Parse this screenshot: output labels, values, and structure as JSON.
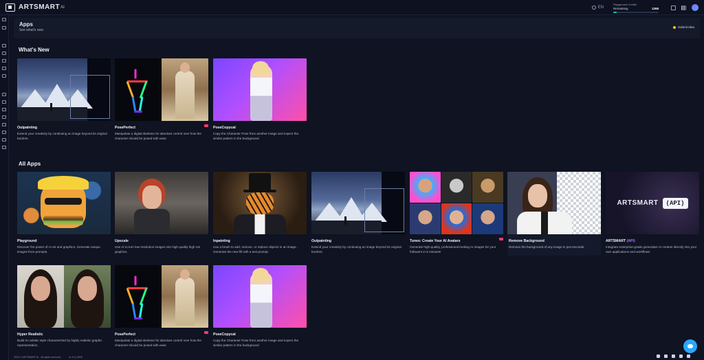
{
  "brand": {
    "name": "ARTSMART",
    "suffix": "AI"
  },
  "topbar": {
    "language": "EN",
    "credits_label": "Playground Credits",
    "credits_remaining_label": "Remaining",
    "credits_value": "1268",
    "credits_progress": 0.08
  },
  "header": {
    "title": "Apps",
    "subtitle": "See what's new",
    "submit_idea": "Submit Idea"
  },
  "sections": {
    "whats_new": "What's New",
    "all_apps": "All Apps"
  },
  "whats_new": [
    {
      "title": "Outpainting",
      "desc": "Extend your creativity by continuing an image beyond its original borders.",
      "badge": false
    },
    {
      "title": "PosePerfect",
      "desc": "Manipulate a digital skeleton for absolute control over how the character should be posed with ease",
      "badge": true
    },
    {
      "title": "PoseCopycat",
      "desc": "Copy the Character Pose from another image and expect the similar pattern in the background",
      "badge": false
    }
  ],
  "all_apps": [
    {
      "title": "Playground",
      "desc": "Discover the power of AI art and graphics. Generate unique images from prompts."
    },
    {
      "title": "Upscale",
      "desc": "Use AI to turn low resolution images into high quality high res graphics."
    },
    {
      "title": "Inpainting",
      "desc": "Use a brush to add, remove, or replace objects in an image. Generate the new fill with a text prompt."
    },
    {
      "title": "Outpainting",
      "desc": "Extend your creativity by continuing an image beyond its original borders."
    },
    {
      "title": "Tunes: Create Your AI Avatars",
      "desc": "Generate high-quality, professional-looking AI images for your followers in 5 minutes!"
    },
    {
      "title": "Remove Background",
      "desc": "Remove the background of any image in just seconds."
    },
    {
      "title_main": "ARTSMART",
      "title_accent": "(API)",
      "desc": "Integrate enterprise-grade generative AI content directly into your own applications and workflows",
      "art_word": "ARTSMART",
      "art_box": "(API)"
    },
    {
      "title": "Hyper Realistic",
      "desc": "Build An artistic style characterized by highly realistic graphic representation."
    },
    {
      "title": "PosePerfect",
      "desc": "Manipulate a digital skeleton for absolute control over how the character should be posed with ease"
    },
    {
      "title": "PoseCopycat",
      "desc": "Copy the Character Pose from another image and expect the similar pattern in the background"
    }
  ],
  "footer": {
    "copyright": "2024 © ARTSMART AI - All rights reserved.",
    "version": "v1.0.5_0928"
  },
  "colors": {
    "background": "#0f1322",
    "accent_badge": "#ff3b6b",
    "chat": "#2aa7ff",
    "api_accent": "#a979ff"
  }
}
